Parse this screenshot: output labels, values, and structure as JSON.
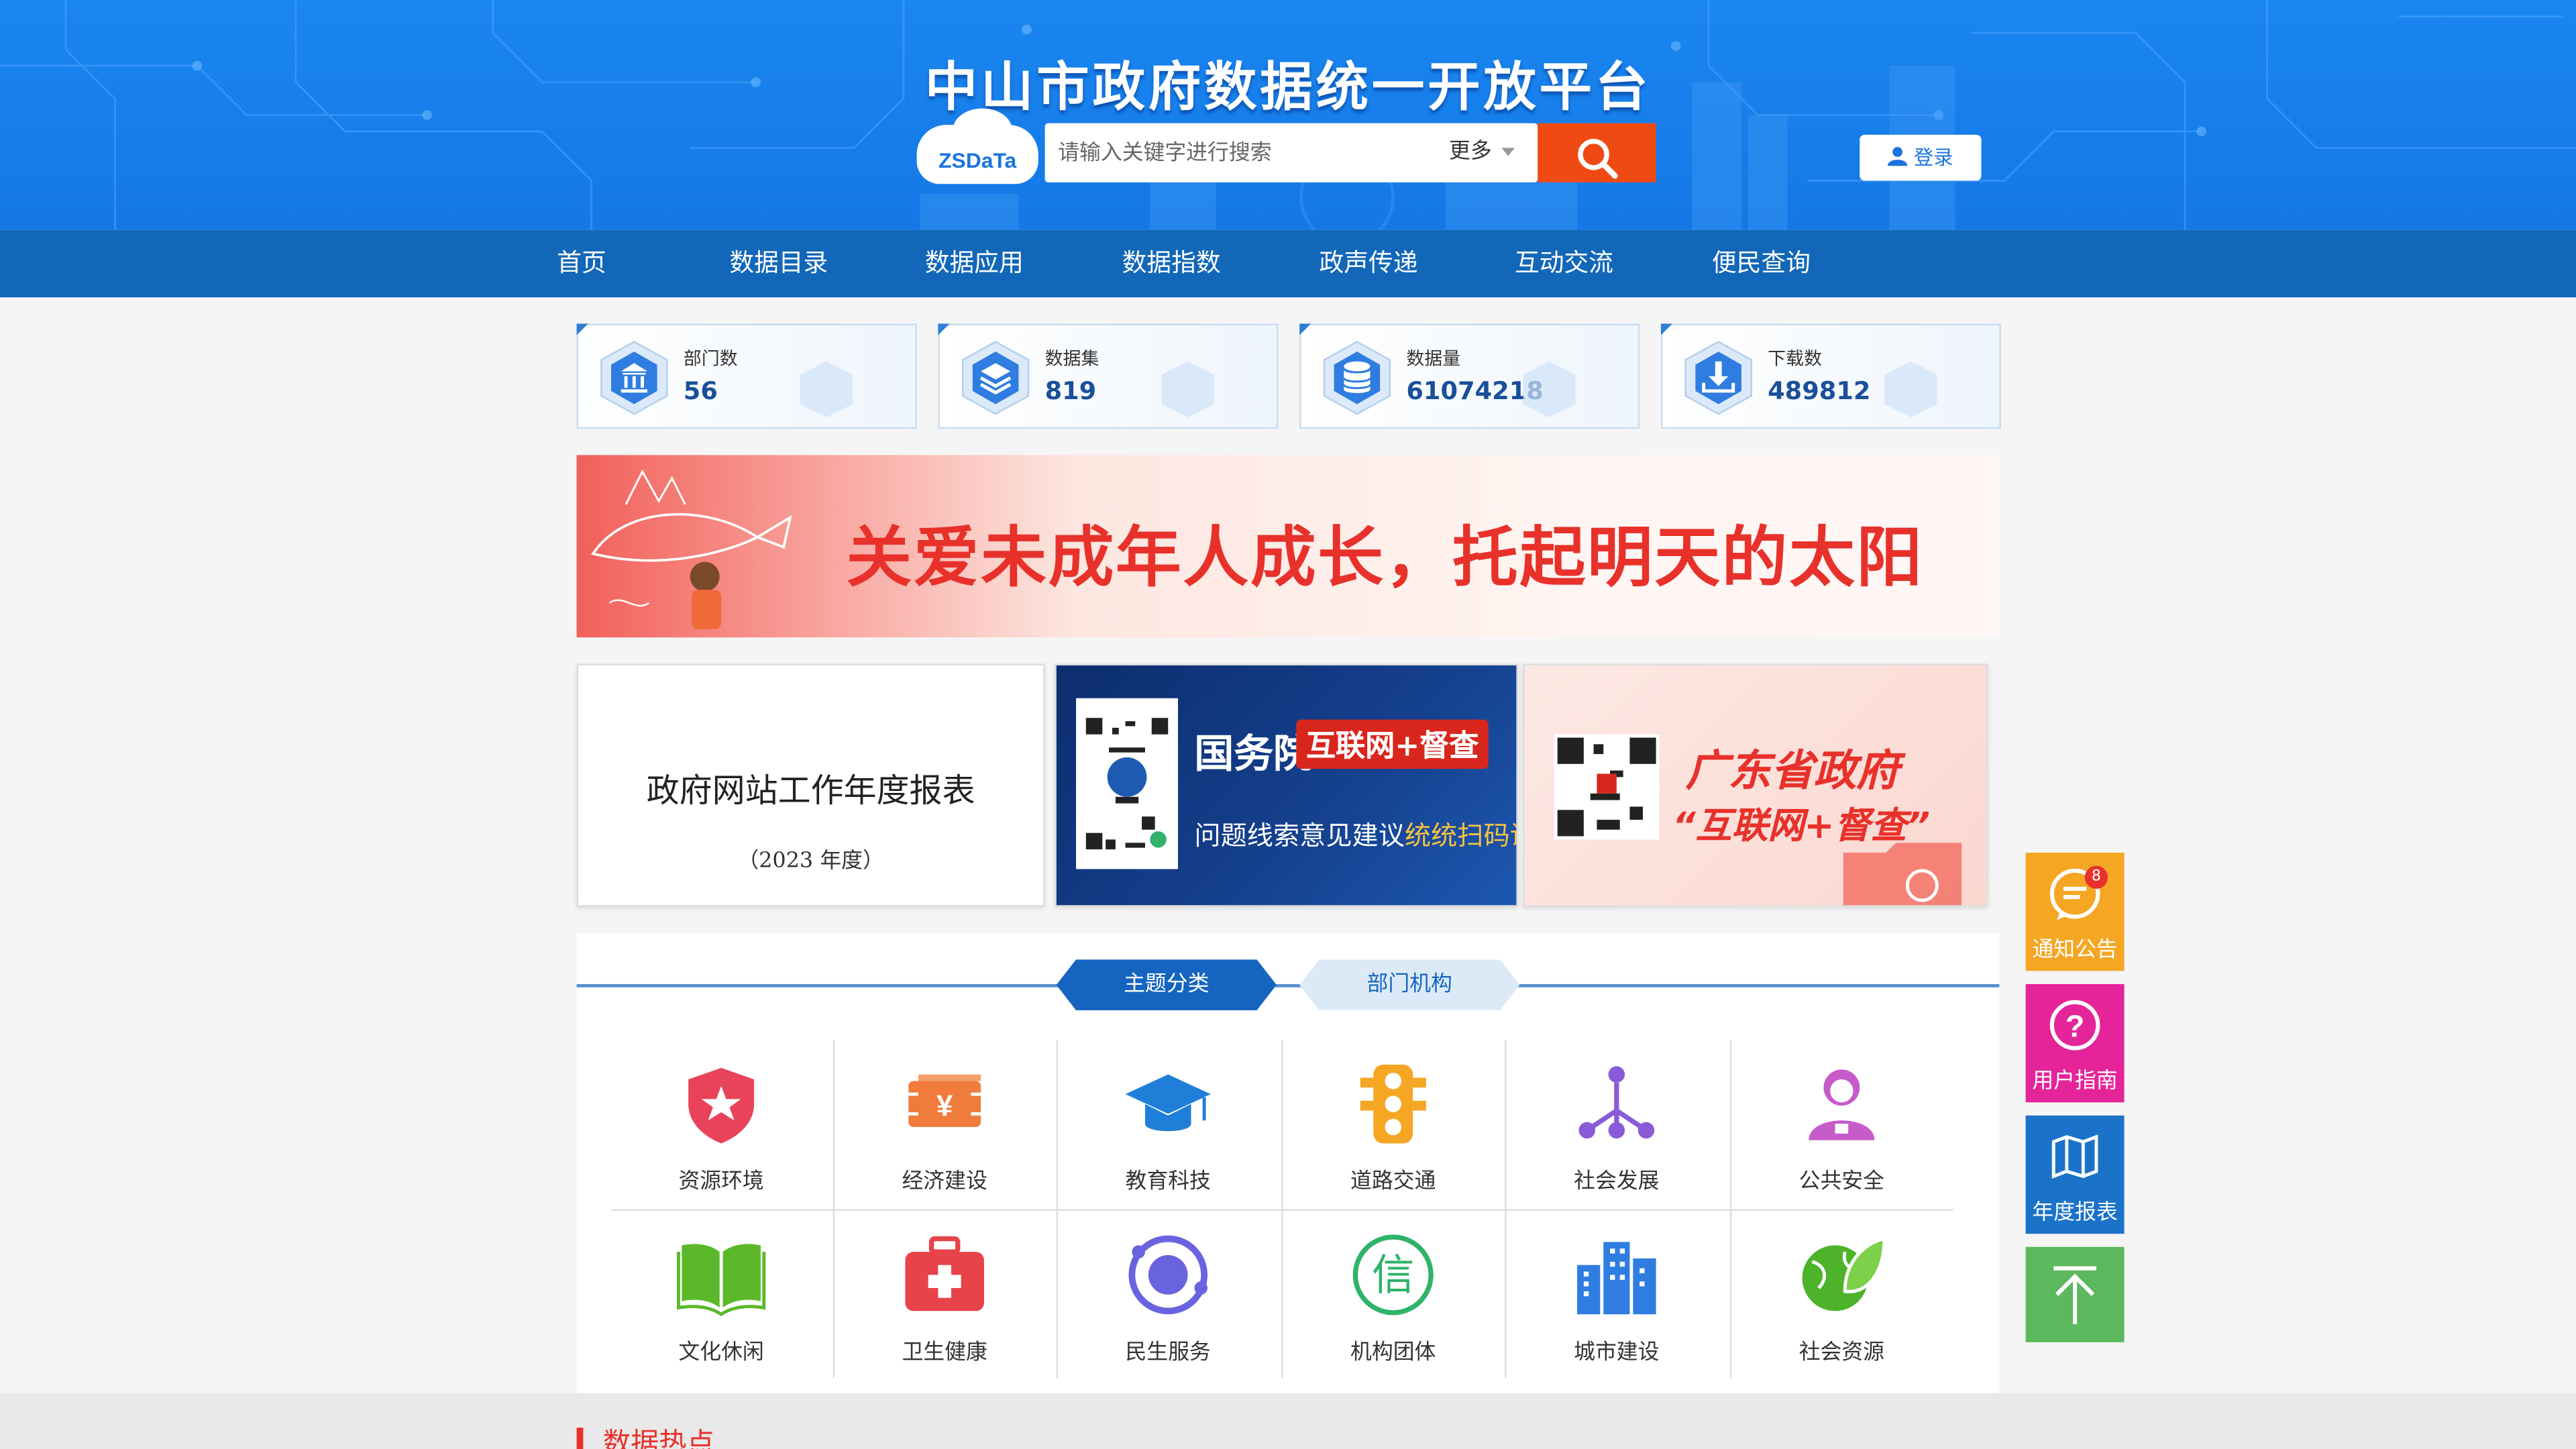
{
  "site": {
    "title": "中山市政府数据统一开放平台",
    "logo_text": "ZSDaTa"
  },
  "search": {
    "placeholder": "请输入关键字进行搜索",
    "more_label": "更多",
    "login_label": "登录"
  },
  "nav": {
    "items": [
      {
        "label": "首页"
      },
      {
        "label": "数据目录"
      },
      {
        "label": "数据应用"
      },
      {
        "label": "数据指数"
      },
      {
        "label": "政声传递"
      },
      {
        "label": "互动交流"
      },
      {
        "label": "便民查询"
      }
    ]
  },
  "stats": [
    {
      "label": "部门数",
      "value": "56",
      "icon": "building-icon"
    },
    {
      "label": "数据集",
      "value": "819",
      "icon": "layers-icon"
    },
    {
      "label": "数据量",
      "value": "61074218",
      "icon": "database-icon"
    },
    {
      "label": "下载数",
      "value": "489812",
      "icon": "download-icon"
    }
  ],
  "banner": {
    "text": "关爱未成年人成长，托起明天的太阳"
  },
  "promos": {
    "report": {
      "title": "政府网站工作年度报表",
      "subtitle": "（2023 年度）"
    },
    "gwy": {
      "title": "国务院",
      "tag": "互联网+督查",
      "sub_prefix": "问题线索意见建议",
      "sub_highlight": "统统扫码说!"
    },
    "gd": {
      "title": "广东省政府",
      "subtitle": "“互联网+督查”"
    }
  },
  "tabs": {
    "active": "主题分类",
    "inactive": "部门机构"
  },
  "categories": [
    {
      "label": "资源环境",
      "icon": "shield-star-icon",
      "color": "#e8435a"
    },
    {
      "label": "经济建设",
      "icon": "yen-ticket-icon",
      "color": "#f07b3a"
    },
    {
      "label": "教育科技",
      "icon": "graduation-cap-icon",
      "color": "#1f7fd8"
    },
    {
      "label": "道路交通",
      "icon": "traffic-light-icon",
      "color": "#f5a623"
    },
    {
      "label": "社会发展",
      "icon": "network-icon",
      "color": "#8a5bd6"
    },
    {
      "label": "公共安全",
      "icon": "person-icon",
      "color": "#c65bc9"
    },
    {
      "label": "文化休闲",
      "icon": "open-book-icon",
      "color": "#5cb82a"
    },
    {
      "label": "卫生健康",
      "icon": "medical-kit-icon",
      "color": "#e8434a"
    },
    {
      "label": "民生服务",
      "icon": "orbit-icon",
      "color": "#6a63e0"
    },
    {
      "label": "机构团体",
      "icon": "xin-icon",
      "color": "#2fb36a"
    },
    {
      "label": "城市建设",
      "icon": "city-buildings-icon",
      "color": "#2f7de0"
    },
    {
      "label": "社会资源",
      "icon": "globe-leaf-icon",
      "color": "#4db32a"
    }
  ],
  "hot": {
    "title": "数据热点"
  },
  "float": {
    "notice_label": "通知公告",
    "notice_badge": "8",
    "guide_label": "用户指南",
    "report_label": "年度报表",
    "colors": {
      "notice": "#f5a623",
      "guide": "#e6249a",
      "report": "#1a73c8",
      "top": "#5cb85c"
    }
  },
  "colors": {
    "header_blue": "#1a86f0",
    "nav_blue": "#1267b8",
    "search_orange": "#f04a14",
    "accent_red": "#e8312a"
  }
}
